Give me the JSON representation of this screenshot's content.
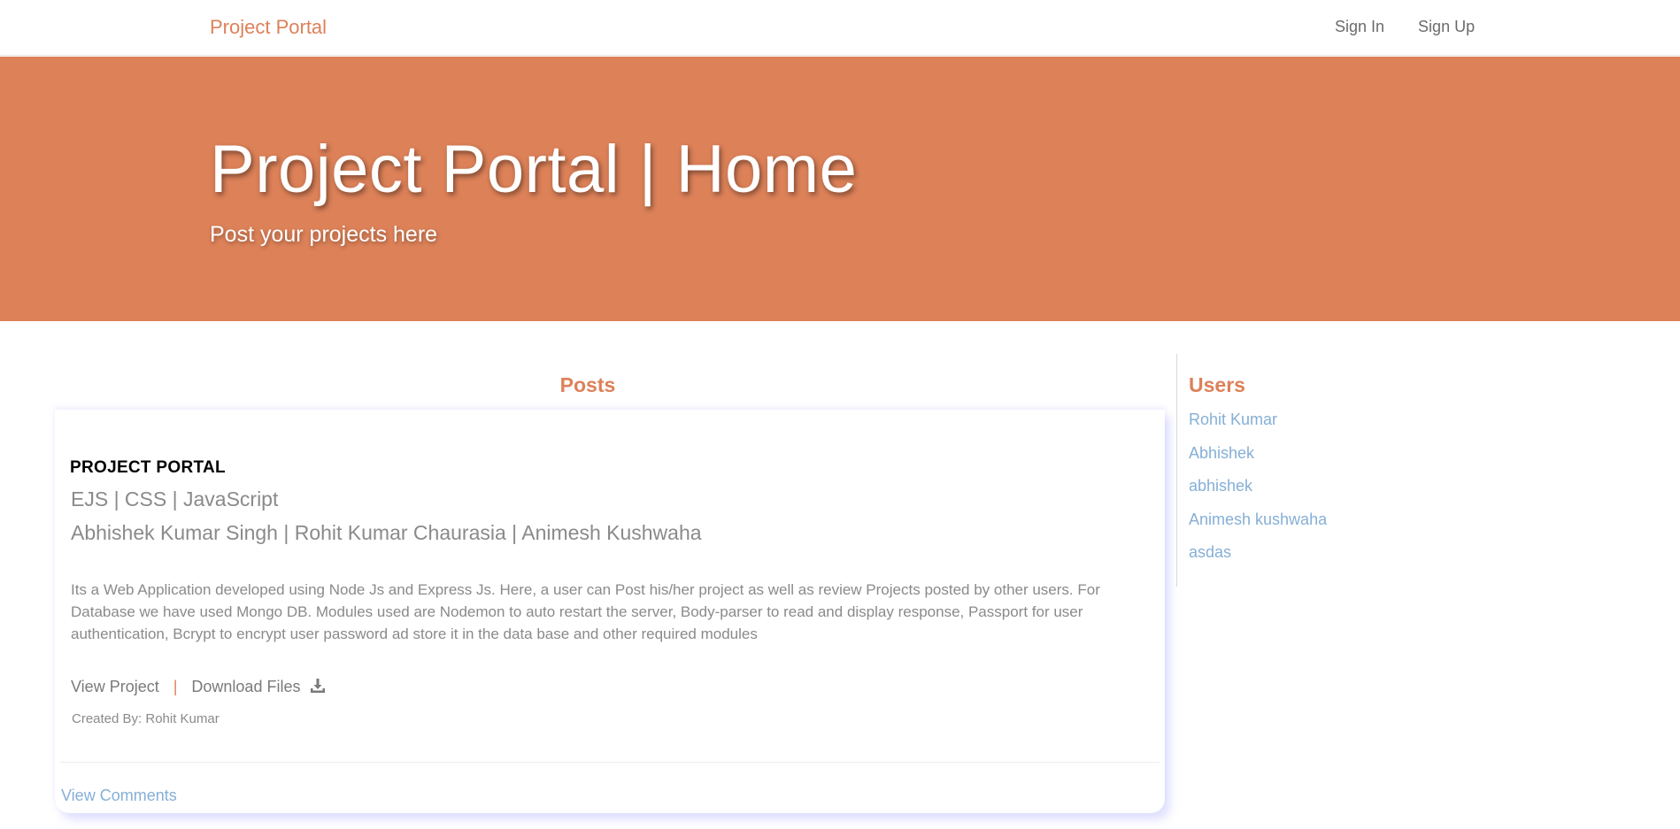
{
  "navbar": {
    "brand": "Project Portal",
    "links": [
      "Sign In",
      "Sign Up"
    ]
  },
  "hero": {
    "title": "Project Portal | Home",
    "subtitle": "Post your projects here"
  },
  "posts": {
    "heading": "Posts",
    "items": [
      {
        "title": "PROJECT PORTAL",
        "tech": "EJS | CSS | JavaScript",
        "authors": "Abhishek Kumar Singh | Rohit Kumar Chaurasia | Animesh Kushwaha",
        "description": "Its a Web Application developed using Node Js and Express Js. Here, a user can Post his/her project as well as review Projects posted by other users. For Database we have used Mongo DB. Modules used are Nodemon to auto restart the server, Body-parser to read and display response, Passport for user authentication, Bcrypt to encrypt user password ad store it in the data base and other required modules",
        "view_project_label": "View Project",
        "separator": "|",
        "download_label": "Download Files",
        "download_icon": "download-icon",
        "created_by": "Created By: Rohit Kumar",
        "view_comments_label": "View Comments"
      }
    ]
  },
  "users": {
    "heading": "Users",
    "items": [
      "Rohit Kumar",
      "Abhishek",
      "abhishek",
      "Animesh kushwaha",
      "asdas"
    ]
  },
  "colors": {
    "accent": "#dc8158",
    "link": "#86afd6",
    "muted_text": "#8a8a8a"
  }
}
